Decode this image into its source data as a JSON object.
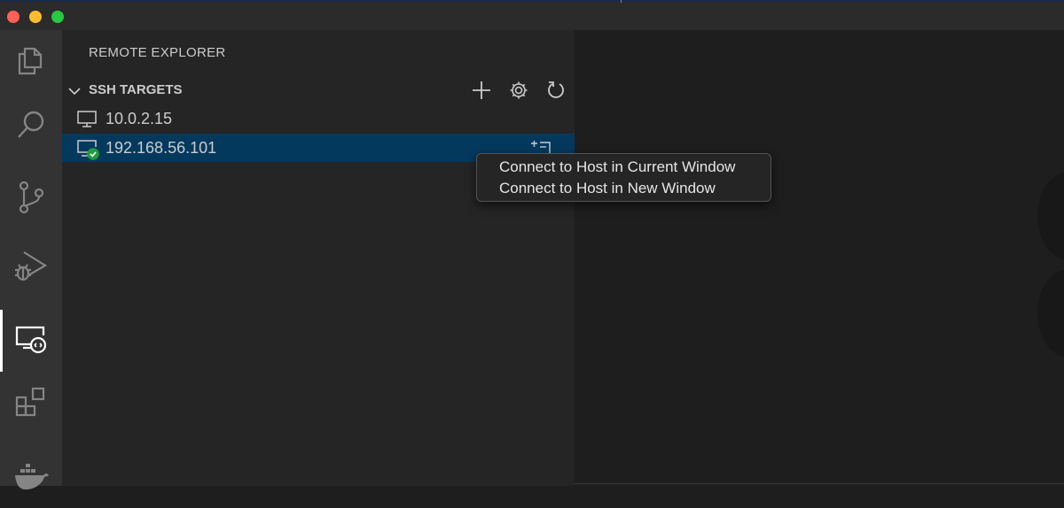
{
  "sidebar": {
    "title": "REMOTE EXPLORER",
    "section": {
      "title": "SSH TARGETS"
    },
    "hosts": [
      {
        "label": "10.0.2.15"
      },
      {
        "label": "192.168.56.101"
      }
    ]
  },
  "context_menu": {
    "items": [
      {
        "label": "Connect to Host in Current Window"
      },
      {
        "label": "Connect to Host in New Window"
      }
    ]
  },
  "colors": {
    "selection": "#04395e",
    "connected_badge": "#1f9d3c",
    "window_close": "#fe5f57",
    "window_minimize": "#febc2e",
    "window_maximize": "#28c840"
  },
  "icons": {
    "activity_bar": [
      "files-icon",
      "search-icon",
      "source-control-icon",
      "run-debug-icon",
      "remote-explorer-icon",
      "extensions-icon",
      "docker-icon"
    ],
    "section_actions": [
      "add-icon",
      "gear-icon",
      "refresh-icon"
    ],
    "host": "monitor-icon",
    "connected_host": "monitor-connected-icon",
    "row_action": "connect-new-window-icon"
  }
}
